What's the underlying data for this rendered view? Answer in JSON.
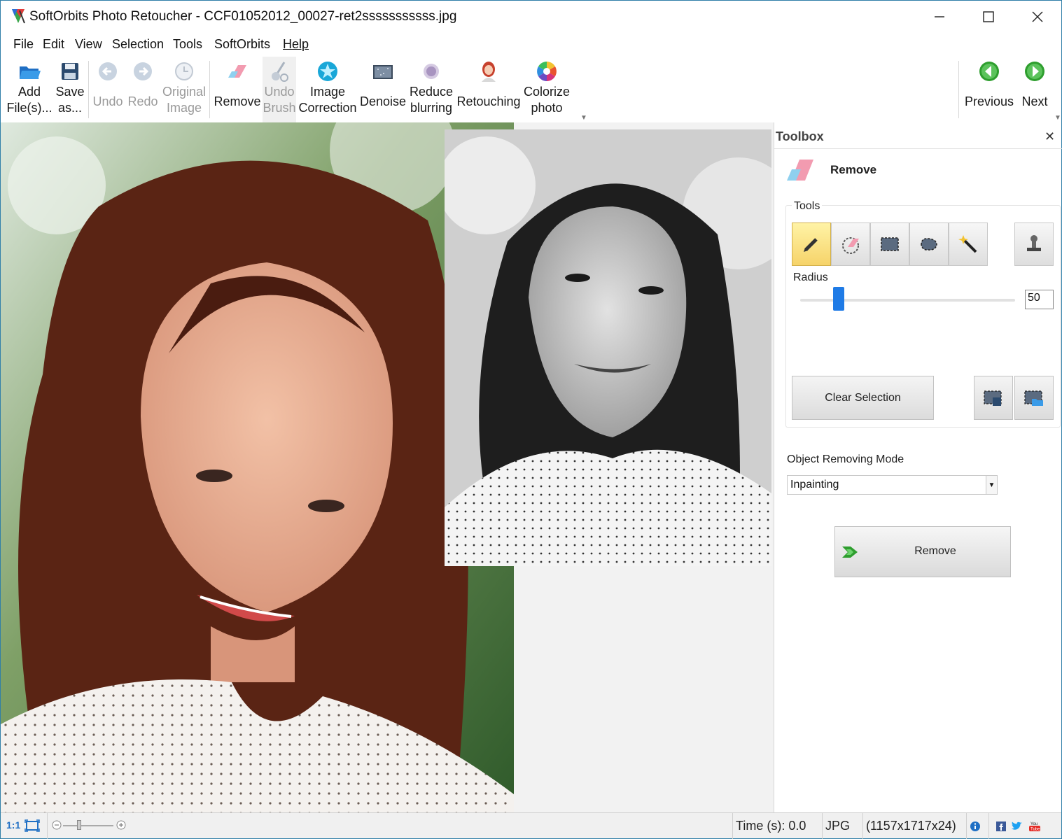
{
  "window": {
    "title": "SoftOrbits Photo Retoucher - CCF01052012_00027-ret2sssssssssss.jpg"
  },
  "menu": [
    {
      "label": "File"
    },
    {
      "label": "Edit"
    },
    {
      "label": "View"
    },
    {
      "label": "Selection"
    },
    {
      "label": "Tools"
    },
    {
      "label": "SoftOrbits"
    },
    {
      "label": "Help"
    }
  ],
  "toolbar": {
    "add_files": {
      "line1": "Add",
      "line2": "File(s)..."
    },
    "save_as": {
      "line1": "Save",
      "line2": "as..."
    },
    "undo": {
      "label": "Undo"
    },
    "redo": {
      "label": "Redo"
    },
    "original_image": {
      "line1": "Original",
      "line2": "Image"
    },
    "remove": {
      "label": "Remove"
    },
    "undo_brush": {
      "line1": "Undo",
      "line2": "Brush"
    },
    "image_correction": {
      "line1": "Image",
      "line2": "Correction"
    },
    "denoise": {
      "label": "Denoise"
    },
    "reduce_blurring": {
      "line1": "Reduce",
      "line2": "blurring"
    },
    "retouching": {
      "label": "Retouching"
    },
    "colorize_photo": {
      "line1": "Colorize",
      "line2": "photo"
    },
    "previous": {
      "label": "Previous"
    },
    "next": {
      "label": "Next"
    }
  },
  "toolbox": {
    "title": "Toolbox",
    "section_title": "Remove",
    "tools_label": "Tools",
    "tools": [
      {
        "name": "pencil",
        "active": true
      },
      {
        "name": "eraser",
        "active": false
      },
      {
        "name": "rect-select",
        "active": false
      },
      {
        "name": "lasso-select",
        "active": false
      },
      {
        "name": "magic-wand",
        "active": false
      },
      {
        "name": "clone-stamp",
        "active": false
      }
    ],
    "radius_label": "Radius",
    "radius_value": "50",
    "radius_slider_fraction": 0.18,
    "clear_selection_label": "Clear Selection",
    "mode_label": "Object Removing Mode",
    "mode_value": "Inpainting",
    "remove_button_label": "Remove"
  },
  "statusbar": {
    "zoom_1to1": "1:1",
    "time": "Time (s): 0.0",
    "format": "JPG",
    "dimensions": "(1157x1717x24)"
  },
  "colors": {
    "accent": "#1f7be6",
    "window_border": "#2f7fa8",
    "active_tool": "#f6d36a",
    "nav_green": "#2e9e2e"
  }
}
